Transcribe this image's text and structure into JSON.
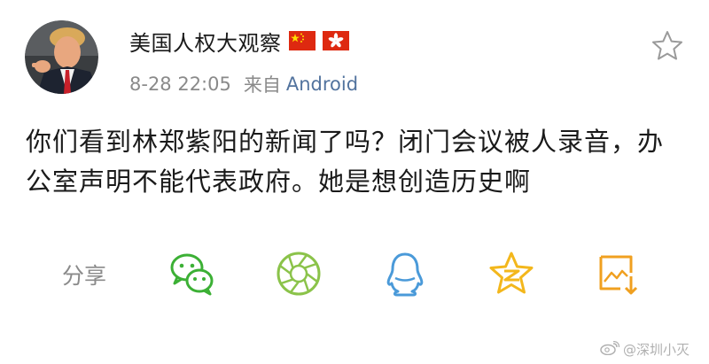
{
  "post": {
    "username": "美国人权大观察",
    "badges": [
      "china-flag-icon",
      "hong-kong-flag-icon"
    ],
    "time": "8-28 22:05",
    "source_prefix": "来自",
    "source_name": "Android",
    "content": "你们看到林郑紫阳的新闻了吗？闭门会议被人录音，办公室声明不能代表政府。她是想创造历史啊"
  },
  "share": {
    "label": "分享",
    "targets": [
      "wechat-icon",
      "wechat-moments-icon",
      "qq-icon",
      "qzone-icon",
      "save-image-icon"
    ]
  },
  "watermark": {
    "text": "@深圳小灭"
  },
  "colors": {
    "text": "#1a1a1a",
    "meta": "#8a8a8a",
    "link": "#52739e",
    "wechat": "#3cb035",
    "moments": "#8bc34a",
    "qq": "#4a9ad9",
    "qzone": "#f3b71c",
    "save": "#f0a020",
    "china_red": "#de2910",
    "china_star": "#ffde00",
    "hk_red": "#de2910"
  }
}
